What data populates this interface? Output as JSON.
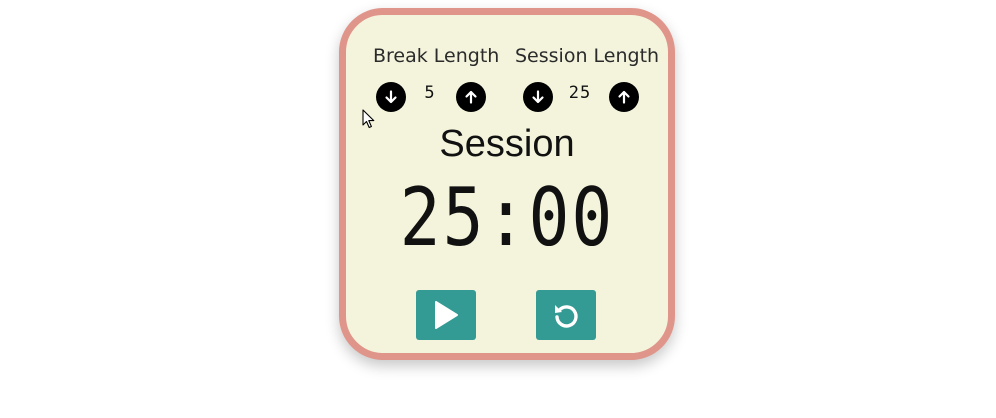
{
  "break": {
    "label": "Break Length",
    "value": "5"
  },
  "session": {
    "label": "Session Length",
    "value": "25"
  },
  "timer": {
    "label": "Session",
    "time_left": "25:00"
  },
  "icons": {
    "decrement": "arrow-down-icon",
    "increment": "arrow-up-icon",
    "start_stop": "play-icon",
    "reset": "reset-icon"
  },
  "colors": {
    "frame_border": "#e0958a",
    "frame_background": "#f4f4dc",
    "control_button": "#339a94",
    "round_button": "#000000"
  }
}
